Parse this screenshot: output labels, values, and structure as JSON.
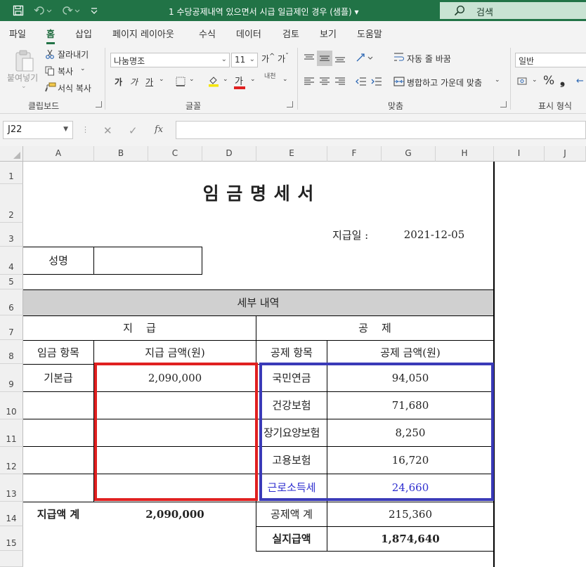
{
  "titlebar": {
    "title": "1 수당공제내역 있으면서 시급 일급제인 경우 (샘플) ▾",
    "search": "검색"
  },
  "ribbon_tabs": [
    "파일",
    "홈",
    "삽입",
    "페이지 레이아웃",
    "수식",
    "데이터",
    "검토",
    "보기",
    "도움말"
  ],
  "active_tab": "홈",
  "ribbon": {
    "clipboard": {
      "paste": "붙여넣기",
      "cut": "잘라내기",
      "copy": "복사",
      "format_painter": "서식 복사",
      "label": "클립보드"
    },
    "font": {
      "name": "나눔명조",
      "size": "11",
      "label": "글꼴",
      "bold": "가",
      "italic": "가",
      "underline": "가",
      "color_btn": "가",
      "phonetic": "내천"
    },
    "alignment": {
      "wrap_text": "자동 줄 바꿈",
      "merge_center": "병합하고 가운데 맞춤",
      "label": "맞춤"
    },
    "number": {
      "format": "일반",
      "label": "표시 형식"
    }
  },
  "formula_bar": {
    "name_box": "J22",
    "fx": "fx",
    "formula": ""
  },
  "columns": [
    "A",
    "B",
    "C",
    "D",
    "E",
    "F",
    "G",
    "H",
    "I",
    "J"
  ],
  "rows": [
    "1",
    "2",
    "3",
    "4",
    "5",
    "6",
    "7",
    "8",
    "9",
    "10",
    "11",
    "12",
    "13",
    "14",
    "15"
  ],
  "sheet": {
    "title": "임 금 명 세 서",
    "pay_date_label": "지급일 :",
    "pay_date": "2021-12-05",
    "name_label": "성명",
    "name_value": "",
    "detail_header": "세부 내역",
    "pay_section": "지    급",
    "deduct_section": "공    제",
    "wage_item_header": "임금 항목",
    "pay_amount_header": "지급 금액(원)",
    "deduct_item_header": "공제 항목",
    "deduct_amount_header": "공제 금액(원)",
    "pay_items": [
      {
        "item": "기본급",
        "amount": "2,090,000"
      },
      {
        "item": "",
        "amount": ""
      },
      {
        "item": "",
        "amount": ""
      },
      {
        "item": "",
        "amount": ""
      },
      {
        "item": "",
        "amount": ""
      }
    ],
    "deduct_items": [
      {
        "item": "국민연금",
        "amount": "94,050"
      },
      {
        "item": "건강보험",
        "amount": "71,680"
      },
      {
        "item": "장기요양보험",
        "amount": "8,250"
      },
      {
        "item": "고용보험",
        "amount": "16,720"
      },
      {
        "item": "근로소득세",
        "amount": "24,660"
      }
    ],
    "pay_total_label": "지급액 계",
    "pay_total": "2,090,000",
    "deduct_total_label": "공제액 계",
    "deduct_total": "215,360",
    "net_pay_label": "실지급액",
    "net_pay": "1,874,640"
  },
  "colors": {
    "excel_green": "#217346",
    "highlight_red": "#e02020",
    "highlight_blue": "#3a3ab8",
    "income_tax_text": "#2d2dcf",
    "detail_header_fill": "#d0d0d0"
  }
}
